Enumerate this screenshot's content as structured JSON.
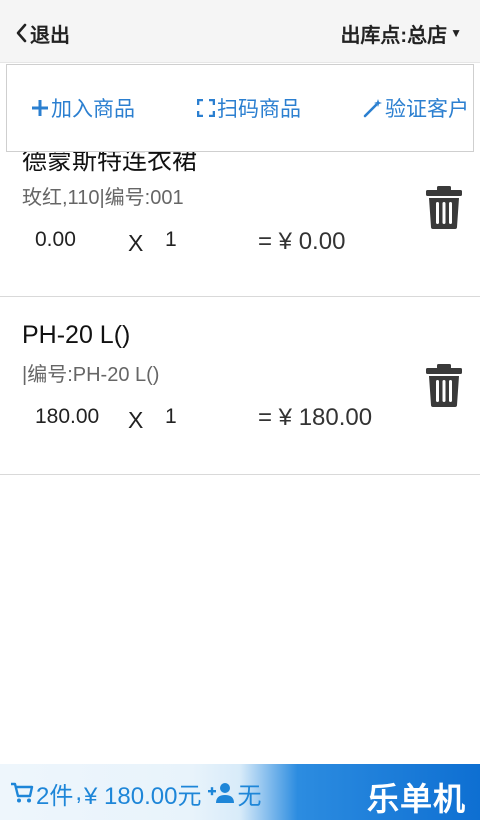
{
  "header": {
    "back_label": "退出",
    "store_label": "出库点:总店"
  },
  "actions": [
    {
      "label": "加入商品",
      "icon": "plus-icon"
    },
    {
      "label": "扫码商品",
      "icon": "scan-icon"
    },
    {
      "label": "验证客户",
      "icon": "magic-wand-icon"
    }
  ],
  "items": [
    {
      "name": "德蒙斯特连衣裙",
      "spec": "玫红,110|编号:001",
      "price": "0.00",
      "times": "X",
      "qty": "1",
      "total": "= ¥ 0.00"
    },
    {
      "name": "PH-20 L()",
      "spec": "|编号:PH-20 L()",
      "price": "180.00",
      "times": "X",
      "qty": "1",
      "total": "= ¥ 180.00"
    }
  ],
  "footer": {
    "count": "2件",
    "amount": "¥ 180.00元",
    "customer": "无",
    "brand": "乐单机"
  },
  "colors": {
    "accent": "#2b7fd0",
    "brand_blue": "#0e6fd2",
    "trash": "#3a3a3a"
  }
}
